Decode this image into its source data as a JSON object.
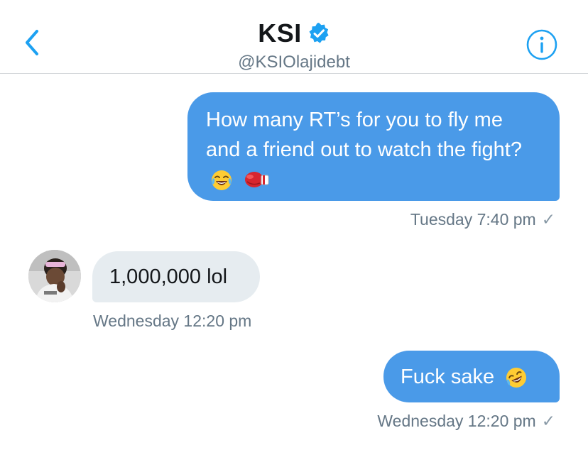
{
  "header": {
    "title": "KSI",
    "handle": "@KSIOlajidebt"
  },
  "messages": [
    {
      "direction": "outgoing",
      "text": "How many RT’s for you to fly me and a friend out to watch the fight?",
      "emojis": [
        "face-with-tears-of-joy",
        "boxing-glove"
      ],
      "timestamp": "Tuesday 7:40 pm",
      "status": "✓"
    },
    {
      "direction": "incoming",
      "text": "1,000,000 lol",
      "timestamp": "Wednesday 12:20 pm"
    },
    {
      "direction": "outgoing",
      "text": "Fuck sake",
      "emojis": [
        "rolling-on-the-floor-laughing"
      ],
      "timestamp": "Wednesday 12:20 pm",
      "status": "✓"
    }
  ],
  "colors": {
    "accent": "#1da1f2",
    "outgoing_bubble": "#4a9ae8",
    "incoming_bubble": "#e6ecf0",
    "meta_text": "#657786"
  }
}
